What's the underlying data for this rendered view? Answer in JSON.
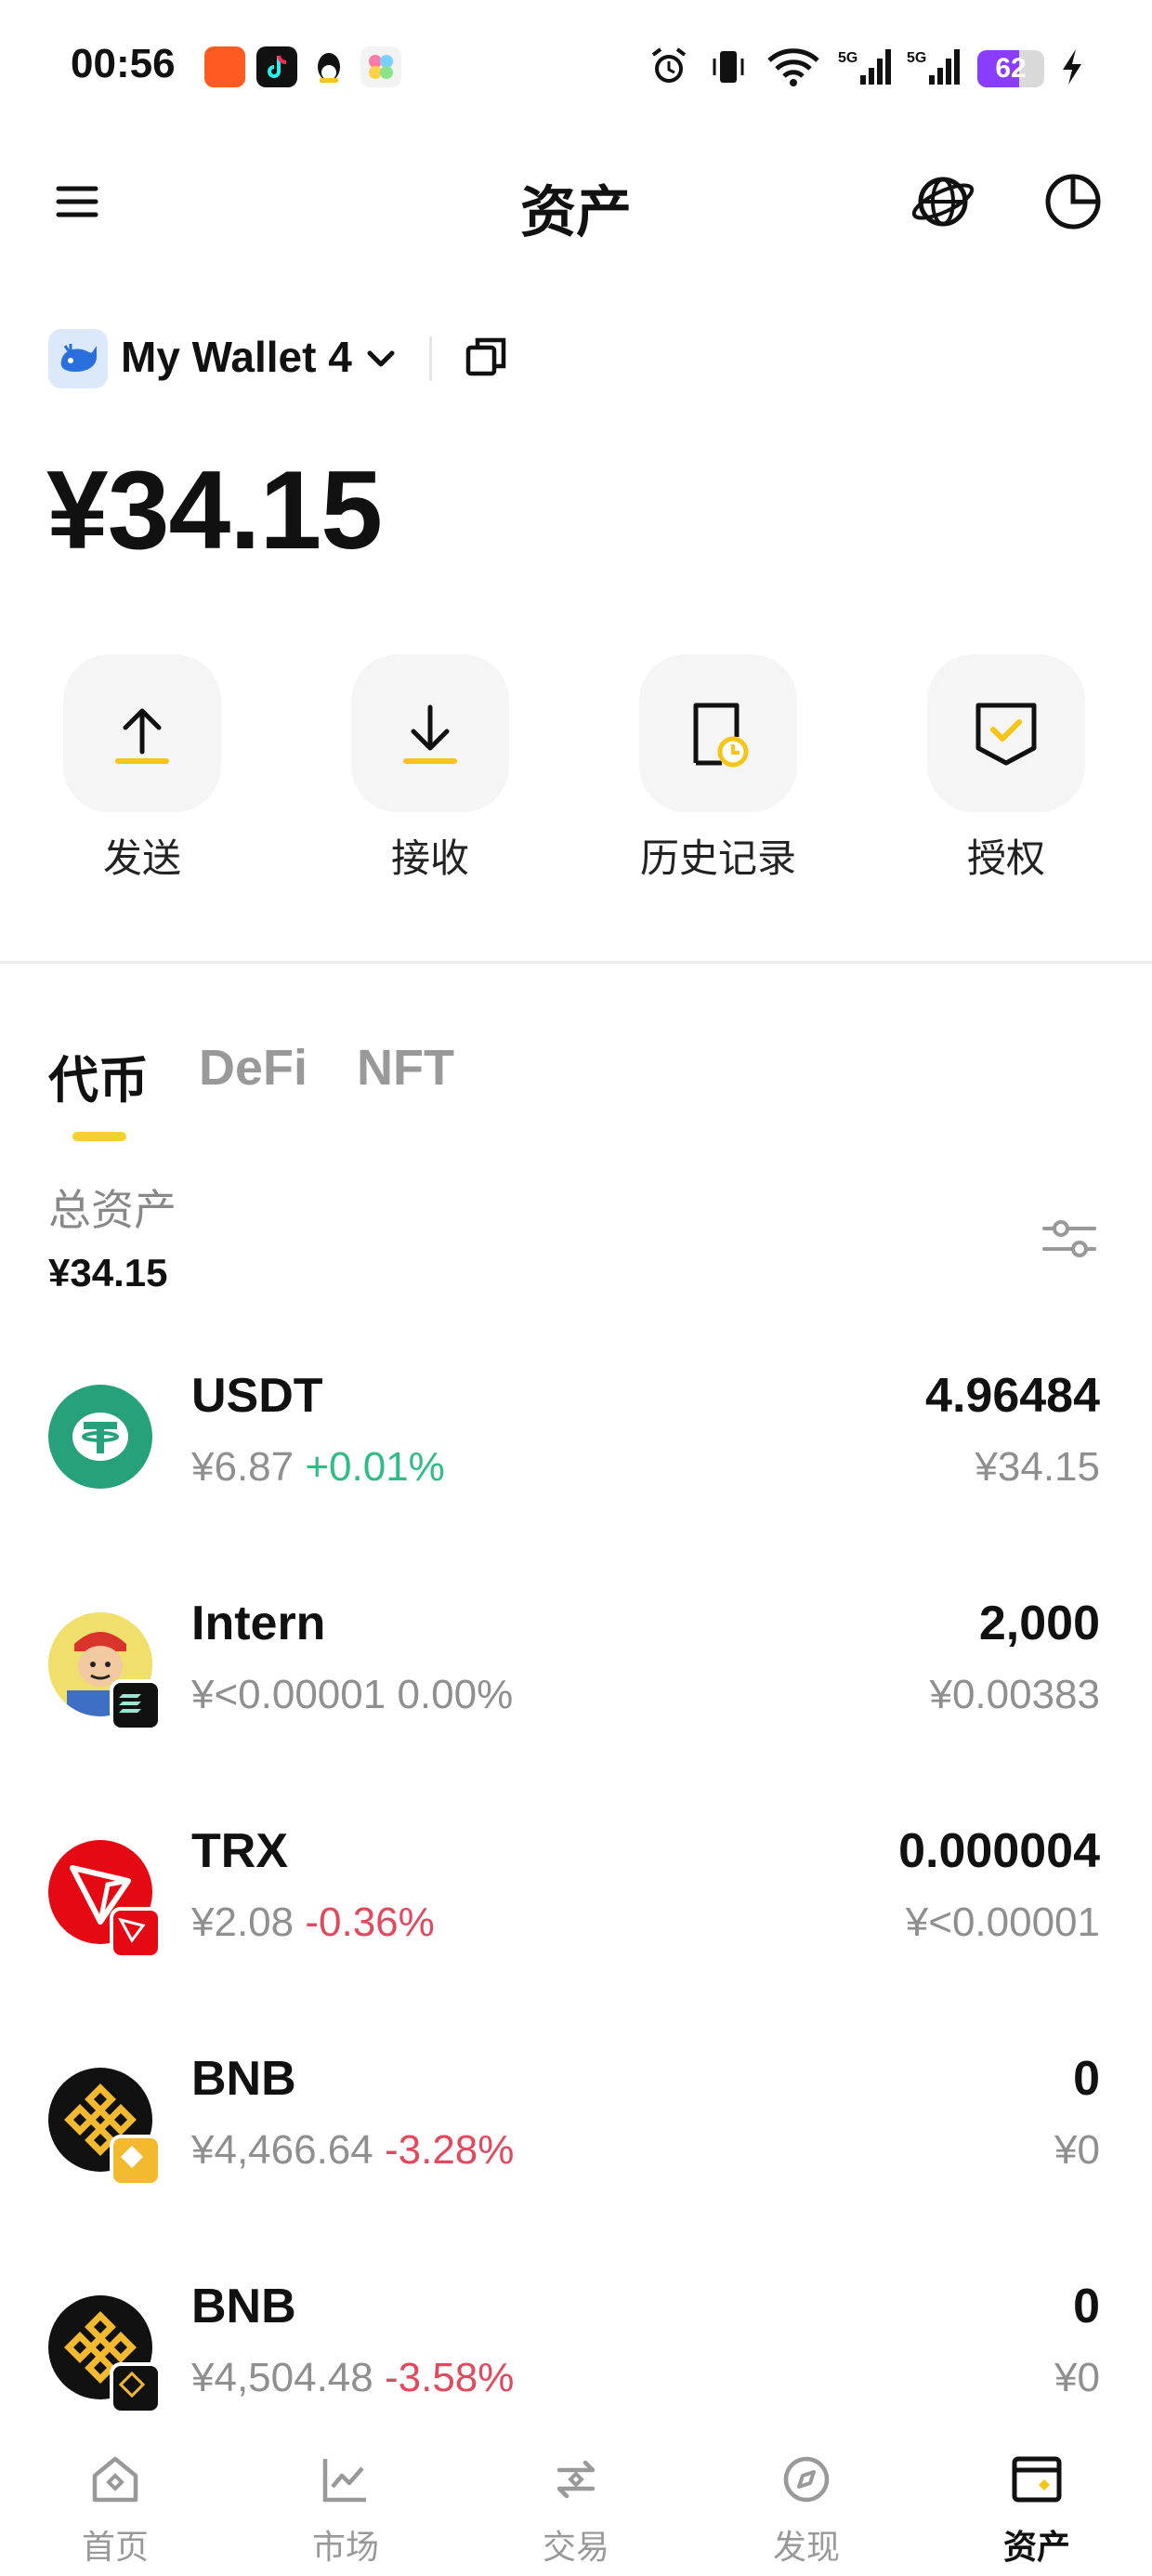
{
  "status_bar": {
    "time": "00:56",
    "battery": "62",
    "battery_level": 0.62
  },
  "header": {
    "title": "资产"
  },
  "wallet": {
    "name": "My Wallet 4",
    "balance": "¥34.15"
  },
  "actions": [
    {
      "label": "发送",
      "icon": "send-icon"
    },
    {
      "label": "接收",
      "icon": "receive-icon"
    },
    {
      "label": "历史记录",
      "icon": "history-icon"
    },
    {
      "label": "授权",
      "icon": "authorize-icon"
    }
  ],
  "tabs": [
    {
      "label": "代币",
      "active": true
    },
    {
      "label": "DeFi",
      "active": false
    },
    {
      "label": "NFT",
      "active": false
    }
  ],
  "summary": {
    "label": "总资产",
    "value": "¥34.15"
  },
  "tokens": [
    {
      "name": "USDT",
      "price": "¥6.87",
      "change": "+0.01%",
      "change_dir": "up",
      "amount": "4.96484",
      "fiat": "¥34.15"
    },
    {
      "name": "Intern",
      "price": "¥<0.00001",
      "change": "0.00%",
      "change_dir": "flat",
      "amount": "2,000",
      "fiat": "¥0.00383"
    },
    {
      "name": "TRX",
      "price": "¥2.08",
      "change": "-0.36%",
      "change_dir": "down",
      "amount": "0.000004",
      "fiat": "¥<0.00001"
    },
    {
      "name": "BNB",
      "price": "¥4,466.64",
      "change": "-3.28%",
      "change_dir": "down",
      "amount": "0",
      "fiat": "¥0"
    },
    {
      "name": "BNB",
      "price": "¥4,504.48",
      "change": "-3.58%",
      "change_dir": "down",
      "amount": "0",
      "fiat": "¥0"
    }
  ],
  "nav": [
    {
      "label": "首页",
      "icon": "home-icon",
      "active": false
    },
    {
      "label": "市场",
      "icon": "market-icon",
      "active": false
    },
    {
      "label": "交易",
      "icon": "trade-icon",
      "active": false
    },
    {
      "label": "发现",
      "icon": "discover-icon",
      "active": false
    },
    {
      "label": "资产",
      "icon": "assets-icon",
      "active": true
    }
  ],
  "colors": {
    "accent": "#f5c518",
    "up": "#2ebd85",
    "down": "#e04a5f",
    "muted": "#8f8f8f"
  }
}
